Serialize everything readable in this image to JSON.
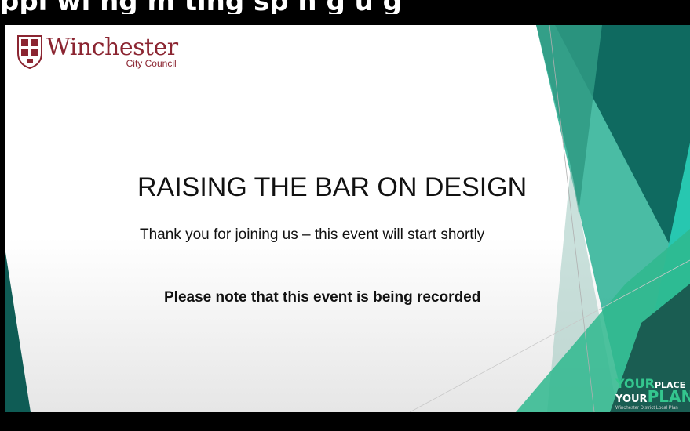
{
  "caption": {
    "top_text": "ppl       wi     ng     m       ting    sp      n    g      u     g"
  },
  "slide": {
    "logo": {
      "name": "Winchester",
      "sub": "City Council"
    },
    "title": "RAISING THE BAR ON DESIGN",
    "subtitle": "Thank you for joining us – this event will start shortly",
    "notice": "Please note that this event is being recorded"
  },
  "brand": {
    "line1_a": "YOUR",
    "line1_b": "PLACE",
    "line2_a": "YOUR",
    "line2_b": "PLAN",
    "tagline": "Winchester District Local Plan"
  },
  "colors": {
    "accent_green": "#34c68e",
    "dark_teal": "#0f5c55",
    "crest_red": "#8b2531"
  },
  "icons": {
    "crest": "city-crest-icon"
  }
}
